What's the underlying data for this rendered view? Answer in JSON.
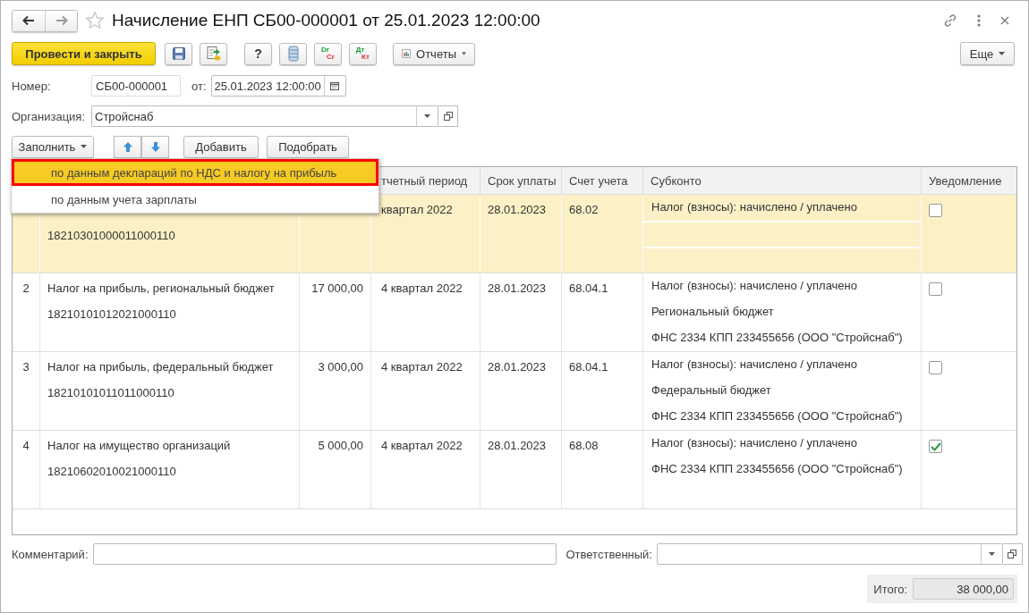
{
  "window": {
    "title": "Начисление ЕНП СБ00-000001 от 25.01.2023 12:00:00"
  },
  "toolbar": {
    "post_button": "Провести и закрыть",
    "help_button": "?",
    "dr_cr": [
      "Dr",
      "Cr"
    ],
    "dt_kt": [
      "Дт",
      "Кт"
    ],
    "reports_button": "Отчеты",
    "more_button": "Еще"
  },
  "number": {
    "label": "Номер:",
    "value": "СБ00-000001",
    "date_label": "от:",
    "date": "25.01.2023 12:00:00"
  },
  "organization": {
    "label": "Организация:",
    "value": "Стройснаб"
  },
  "table_buttons": {
    "fill": "Заполнить",
    "add": "Добавить",
    "pick": "Подобрать"
  },
  "fill_menu": [
    {
      "label": "по данным деклараций по НДС и налогу на прибыль",
      "selected": true
    },
    {
      "label": "по данным учета зарплаты",
      "selected": false
    }
  ],
  "table": {
    "columns": [
      "тчетный период",
      "Срок уплаты",
      "Счет учета",
      "Субконто",
      "Уведомление"
    ],
    "rows": [
      {
        "code": "18210301000011000110",
        "period": "квартал 2022",
        "due": "28.01.2023",
        "account": "68.02",
        "subconto": [
          "Налог (взносы): начислено / уплачено"
        ],
        "notified": false,
        "selected": true
      },
      {
        "number": "2",
        "name": "Налог на прибыль, региональный бюджет",
        "code": "18210101012021000110",
        "sum": "17 000,00",
        "period": "4 квартал 2022",
        "due": "28.01.2023",
        "account": "68.04.1",
        "subconto": [
          "Налог (взносы): начислено / уплачено",
          "Региональный бюджет",
          "ФНС 2334 КПП 233455656 (ООО \"Стройснаб\")"
        ],
        "notified": false,
        "selected": false
      },
      {
        "number": "3",
        "name": "Налог на прибыль, федеральный бюджет",
        "code": "18210101011011000110",
        "sum": "3 000,00",
        "period": "4 квартал 2022",
        "due": "28.01.2023",
        "account": "68.04.1",
        "subconto": [
          "Налог (взносы): начислено / уплачено",
          "Федеральный бюджет",
          "ФНС 2334 КПП 233455656 (ООО \"Стройснаб\")"
        ],
        "notified": false,
        "selected": false
      },
      {
        "number": "4",
        "name": "Налог на имущество организаций",
        "code": "18210602010021000110",
        "sum": "5 000,00",
        "period": "4 квартал 2022",
        "due": "28.01.2023",
        "account": "68.08",
        "subconto": [
          "Налог (взносы): начислено / уплачено",
          "ФНС 2334 КПП 233455656 (ООО \"Стройснаб\")"
        ],
        "notified": true,
        "selected": false
      }
    ]
  },
  "footer": {
    "comment_label": "Комментарий:",
    "responsible_label": "Ответственный:",
    "total_label": "Итого:",
    "total": "38 000,00"
  }
}
